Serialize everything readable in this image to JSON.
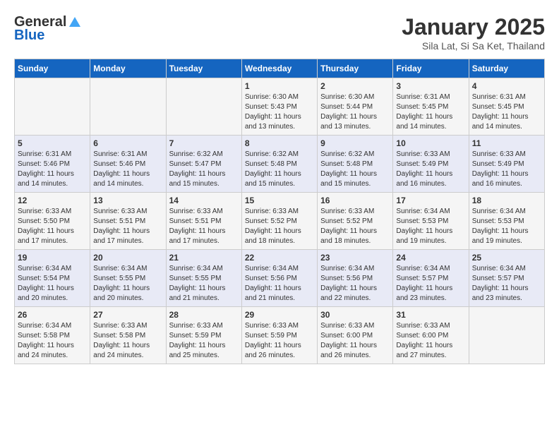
{
  "header": {
    "logo_general": "General",
    "logo_blue": "Blue",
    "title": "January 2025",
    "subtitle": "Sila Lat, Si Sa Ket, Thailand"
  },
  "days_of_week": [
    "Sunday",
    "Monday",
    "Tuesday",
    "Wednesday",
    "Thursday",
    "Friday",
    "Saturday"
  ],
  "weeks": [
    [
      {
        "day": "",
        "info": ""
      },
      {
        "day": "",
        "info": ""
      },
      {
        "day": "",
        "info": ""
      },
      {
        "day": "1",
        "info": "Sunrise: 6:30 AM\nSunset: 5:43 PM\nDaylight: 11 hours\nand 13 minutes."
      },
      {
        "day": "2",
        "info": "Sunrise: 6:30 AM\nSunset: 5:44 PM\nDaylight: 11 hours\nand 13 minutes."
      },
      {
        "day": "3",
        "info": "Sunrise: 6:31 AM\nSunset: 5:45 PM\nDaylight: 11 hours\nand 14 minutes."
      },
      {
        "day": "4",
        "info": "Sunrise: 6:31 AM\nSunset: 5:45 PM\nDaylight: 11 hours\nand 14 minutes."
      }
    ],
    [
      {
        "day": "5",
        "info": "Sunrise: 6:31 AM\nSunset: 5:46 PM\nDaylight: 11 hours\nand 14 minutes."
      },
      {
        "day": "6",
        "info": "Sunrise: 6:31 AM\nSunset: 5:46 PM\nDaylight: 11 hours\nand 14 minutes."
      },
      {
        "day": "7",
        "info": "Sunrise: 6:32 AM\nSunset: 5:47 PM\nDaylight: 11 hours\nand 15 minutes."
      },
      {
        "day": "8",
        "info": "Sunrise: 6:32 AM\nSunset: 5:48 PM\nDaylight: 11 hours\nand 15 minutes."
      },
      {
        "day": "9",
        "info": "Sunrise: 6:32 AM\nSunset: 5:48 PM\nDaylight: 11 hours\nand 15 minutes."
      },
      {
        "day": "10",
        "info": "Sunrise: 6:33 AM\nSunset: 5:49 PM\nDaylight: 11 hours\nand 16 minutes."
      },
      {
        "day": "11",
        "info": "Sunrise: 6:33 AM\nSunset: 5:49 PM\nDaylight: 11 hours\nand 16 minutes."
      }
    ],
    [
      {
        "day": "12",
        "info": "Sunrise: 6:33 AM\nSunset: 5:50 PM\nDaylight: 11 hours\nand 17 minutes."
      },
      {
        "day": "13",
        "info": "Sunrise: 6:33 AM\nSunset: 5:51 PM\nDaylight: 11 hours\nand 17 minutes."
      },
      {
        "day": "14",
        "info": "Sunrise: 6:33 AM\nSunset: 5:51 PM\nDaylight: 11 hours\nand 17 minutes."
      },
      {
        "day": "15",
        "info": "Sunrise: 6:33 AM\nSunset: 5:52 PM\nDaylight: 11 hours\nand 18 minutes."
      },
      {
        "day": "16",
        "info": "Sunrise: 6:33 AM\nSunset: 5:52 PM\nDaylight: 11 hours\nand 18 minutes."
      },
      {
        "day": "17",
        "info": "Sunrise: 6:34 AM\nSunset: 5:53 PM\nDaylight: 11 hours\nand 19 minutes."
      },
      {
        "day": "18",
        "info": "Sunrise: 6:34 AM\nSunset: 5:53 PM\nDaylight: 11 hours\nand 19 minutes."
      }
    ],
    [
      {
        "day": "19",
        "info": "Sunrise: 6:34 AM\nSunset: 5:54 PM\nDaylight: 11 hours\nand 20 minutes."
      },
      {
        "day": "20",
        "info": "Sunrise: 6:34 AM\nSunset: 5:55 PM\nDaylight: 11 hours\nand 20 minutes."
      },
      {
        "day": "21",
        "info": "Sunrise: 6:34 AM\nSunset: 5:55 PM\nDaylight: 11 hours\nand 21 minutes."
      },
      {
        "day": "22",
        "info": "Sunrise: 6:34 AM\nSunset: 5:56 PM\nDaylight: 11 hours\nand 21 minutes."
      },
      {
        "day": "23",
        "info": "Sunrise: 6:34 AM\nSunset: 5:56 PM\nDaylight: 11 hours\nand 22 minutes."
      },
      {
        "day": "24",
        "info": "Sunrise: 6:34 AM\nSunset: 5:57 PM\nDaylight: 11 hours\nand 23 minutes."
      },
      {
        "day": "25",
        "info": "Sunrise: 6:34 AM\nSunset: 5:57 PM\nDaylight: 11 hours\nand 23 minutes."
      }
    ],
    [
      {
        "day": "26",
        "info": "Sunrise: 6:34 AM\nSunset: 5:58 PM\nDaylight: 11 hours\nand 24 minutes."
      },
      {
        "day": "27",
        "info": "Sunrise: 6:33 AM\nSunset: 5:58 PM\nDaylight: 11 hours\nand 24 minutes."
      },
      {
        "day": "28",
        "info": "Sunrise: 6:33 AM\nSunset: 5:59 PM\nDaylight: 11 hours\nand 25 minutes."
      },
      {
        "day": "29",
        "info": "Sunrise: 6:33 AM\nSunset: 5:59 PM\nDaylight: 11 hours\nand 26 minutes."
      },
      {
        "day": "30",
        "info": "Sunrise: 6:33 AM\nSunset: 6:00 PM\nDaylight: 11 hours\nand 26 minutes."
      },
      {
        "day": "31",
        "info": "Sunrise: 6:33 AM\nSunset: 6:00 PM\nDaylight: 11 hours\nand 27 minutes."
      },
      {
        "day": "",
        "info": ""
      }
    ]
  ]
}
